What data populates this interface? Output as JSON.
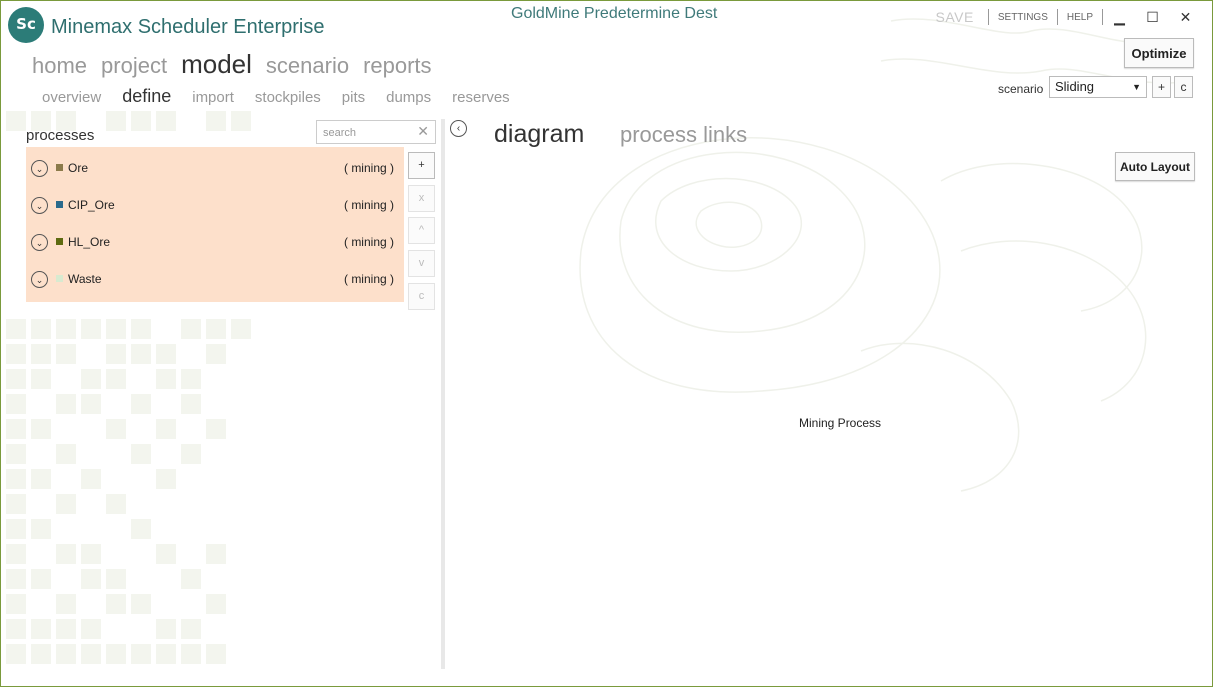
{
  "app": {
    "logo_text": "Sc",
    "title": "Minemax Scheduler Enterprise",
    "document_title": "GoldMine Predetermine Dest"
  },
  "top_bar": {
    "save_label": "SAVE",
    "settings_label": "SETTINGS",
    "help_label": "HELP",
    "minimize_glyph": "▁",
    "maximize_glyph": "☐",
    "close_glyph": "✕"
  },
  "toolbar": {
    "optimize_label": "Optimize"
  },
  "main_nav": [
    {
      "label": "home",
      "active": false
    },
    {
      "label": "project",
      "active": false
    },
    {
      "label": "model",
      "active": true
    },
    {
      "label": "scenario",
      "active": false
    },
    {
      "label": "reports",
      "active": false
    }
  ],
  "sub_nav": [
    {
      "label": "overview",
      "active": false
    },
    {
      "label": "define",
      "active": true
    },
    {
      "label": "import",
      "active": false
    },
    {
      "label": "stockpiles",
      "active": false
    },
    {
      "label": "pits",
      "active": false
    },
    {
      "label": "dumps",
      "active": false
    },
    {
      "label": "reserves",
      "active": false
    }
  ],
  "scenario": {
    "label": "scenario",
    "selected": "Sliding",
    "dropdown_glyph": "▼",
    "add_label": "+",
    "copy_label": "c"
  },
  "processes_panel": {
    "title": "processes",
    "search_placeholder": "search",
    "search_clear_glyph": "✕",
    "list_background": "#fde0cb",
    "items": [
      {
        "name": "Ore",
        "type": "( mining )",
        "color": "#8b7a4a"
      },
      {
        "name": "CIP_Ore",
        "type": "( mining )",
        "color": "#2a6a8c"
      },
      {
        "name": "HL_Ore",
        "type": "( mining )",
        "color": "#5e6a10"
      },
      {
        "name": "Waste",
        "type": "( mining )",
        "color": "#d8ead0"
      }
    ],
    "expand_glyph": "⌄",
    "side_buttons": [
      {
        "label": "+",
        "enabled": true
      },
      {
        "label": "x",
        "enabled": false
      },
      {
        "label": "^",
        "enabled": false
      },
      {
        "label": "v",
        "enabled": false
      },
      {
        "label": "c",
        "enabled": false
      }
    ]
  },
  "collapse_glyph": "‹",
  "diagram_panel": {
    "tabs": [
      {
        "label": "diagram",
        "active": true
      },
      {
        "label": "process links",
        "active": false
      }
    ],
    "auto_layout_label": "Auto Layout",
    "node_label": "Mining Process"
  },
  "colors": {
    "accent": "#2c7c78",
    "window_border": "#7a9a3c"
  }
}
